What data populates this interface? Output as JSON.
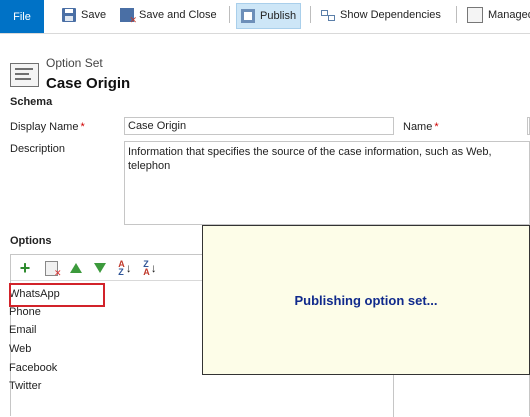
{
  "ribbon": {
    "file_label": "File",
    "save_label": "Save",
    "save_close_label": "Save and Close",
    "publish_label": "Publish",
    "show_dependencies_label": "Show Dependencies",
    "managed_label": "Managed"
  },
  "header": {
    "entity_type": "Option Set",
    "entity_name": "Case Origin"
  },
  "schema": {
    "section_label": "Schema",
    "display_name_label": "Display Name",
    "display_name_value": "Case Origin",
    "name_label": "Name",
    "description_label": "Description",
    "description_value": "Information that specifies the source of the case information, such as Web, telephon"
  },
  "options": {
    "section_label": "Options",
    "items": [
      "WhatsApp",
      "Phone",
      "Email",
      "Web",
      "Facebook",
      "Twitter"
    ]
  },
  "overlay": {
    "message": "Publishing option set..."
  },
  "colors": {
    "file_tab": "#0072c6",
    "required": "#d00000",
    "highlight": "#d2232a",
    "overlay_bg": "#fdfde8",
    "overlay_text": "#102a8c"
  },
  "icons": {
    "add": "plus-icon",
    "delete": "delete-icon",
    "move_up": "arrow-up-icon",
    "move_down": "arrow-down-icon",
    "sort_asc": "sort-ascending-icon",
    "sort_desc": "sort-descending-icon"
  }
}
